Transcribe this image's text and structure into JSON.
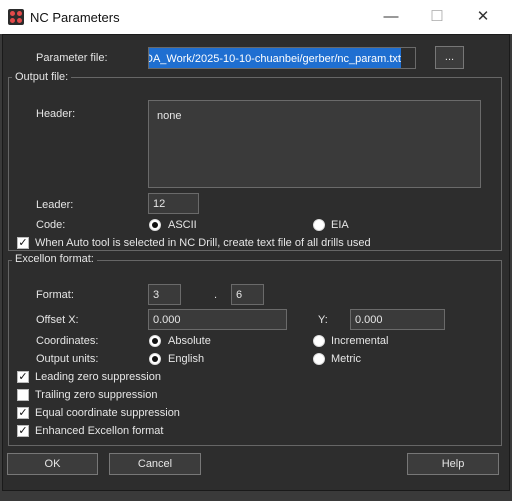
{
  "window": {
    "title": "NC Parameters",
    "minimize_glyph": "—",
    "maximize_glyph": "☐",
    "close_glyph": "✕"
  },
  "parameter_file": {
    "label": "Parameter file:",
    "value": "DA_Work/2025-10-10-chuanbei/gerber/nc_param.txt",
    "browse_label": "..."
  },
  "output_file": {
    "group_label": "Output file:",
    "header_label": "Header:",
    "header_value": "none",
    "leader_label": "Leader:",
    "leader_value": "12",
    "code_label": "Code:",
    "code_options": [
      "ASCII",
      "EIA"
    ],
    "code_selected": "ASCII",
    "auto_tool_label": "When Auto tool is selected in NC Drill, create text file of all drills used",
    "auto_tool_checked": true
  },
  "excellon": {
    "group_label": "Excellon format:",
    "format_label": "Format:",
    "format_int": "3",
    "format_sep": ".",
    "format_dec": "6",
    "offset_x_label": "Offset X:",
    "offset_x_value": "0.000",
    "offset_y_label": "Y:",
    "offset_y_value": "0.000",
    "coordinates_label": "Coordinates:",
    "coordinates_options": [
      "Absolute",
      "Incremental"
    ],
    "coordinates_selected": "Absolute",
    "units_label": "Output units:",
    "units_options": [
      "English",
      "Metric"
    ],
    "units_selected": "English",
    "checkboxes": [
      {
        "label": "Leading zero suppression",
        "checked": true
      },
      {
        "label": "Trailing zero suppression",
        "checked": false
      },
      {
        "label": "Equal coordinate suppression",
        "checked": true
      },
      {
        "label": "Enhanced Excellon format",
        "checked": true
      }
    ]
  },
  "buttons": {
    "ok": "OK",
    "cancel": "Cancel",
    "help": "Help"
  },
  "check_glyph": "✓"
}
